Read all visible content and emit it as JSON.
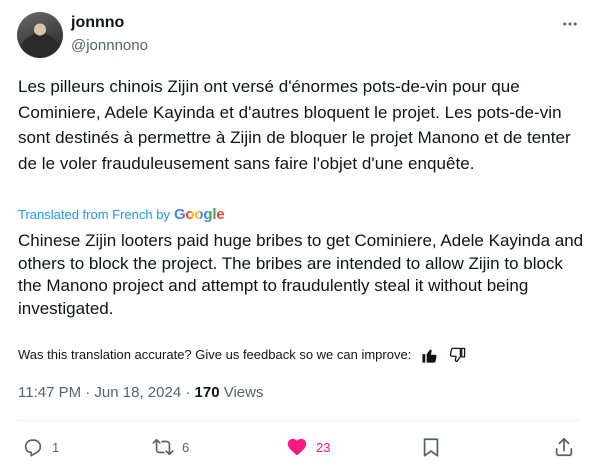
{
  "author": {
    "display_name": "jonnno",
    "handle": "@jonnnono"
  },
  "tweet": {
    "original_text": "Les pilleurs chinois Zijin ont versé d'énormes pots-de-vin pour que Cominiere, Adele Kayinda et d'autres bloquent le projet. Les pots-de-vin sont destinés à permettre à Zijin de bloquer le projet Manono et de tenter de le voler frauduleusement sans faire l'objet d'une enquête.",
    "translated_from_label": "Translated from French by",
    "translation_provider": "Google",
    "translated_text": "Chinese Zijin looters paid huge bribes to get Cominiere, Adele Kayinda and others to block the project. The bribes are intended to allow Zijin to block the Manono project and attempt to fraudulently steal it without being investigated.",
    "feedback_prompt": "Was this translation accurate? Give us feedback so we can improve:",
    "timestamp": "11:47 PM · Jun 18, 2024",
    "separator": " · ",
    "views_count": "170",
    "views_label": "Views"
  },
  "actions": {
    "replies": "1",
    "reposts": "6",
    "likes": "23"
  },
  "colors": {
    "text": "#0f1419",
    "secondary": "#536471",
    "link": "#1d9bf0",
    "like": "#f91880",
    "divider": "#eff3f4"
  },
  "icons": {
    "more": "more-horizontal-icon",
    "thumbs_up": "thumbs-up-icon",
    "thumbs_down": "thumbs-down-icon",
    "reply": "reply-icon",
    "repost": "repost-icon",
    "like": "heart-icon",
    "bookmark": "bookmark-icon",
    "share": "share-icon"
  }
}
